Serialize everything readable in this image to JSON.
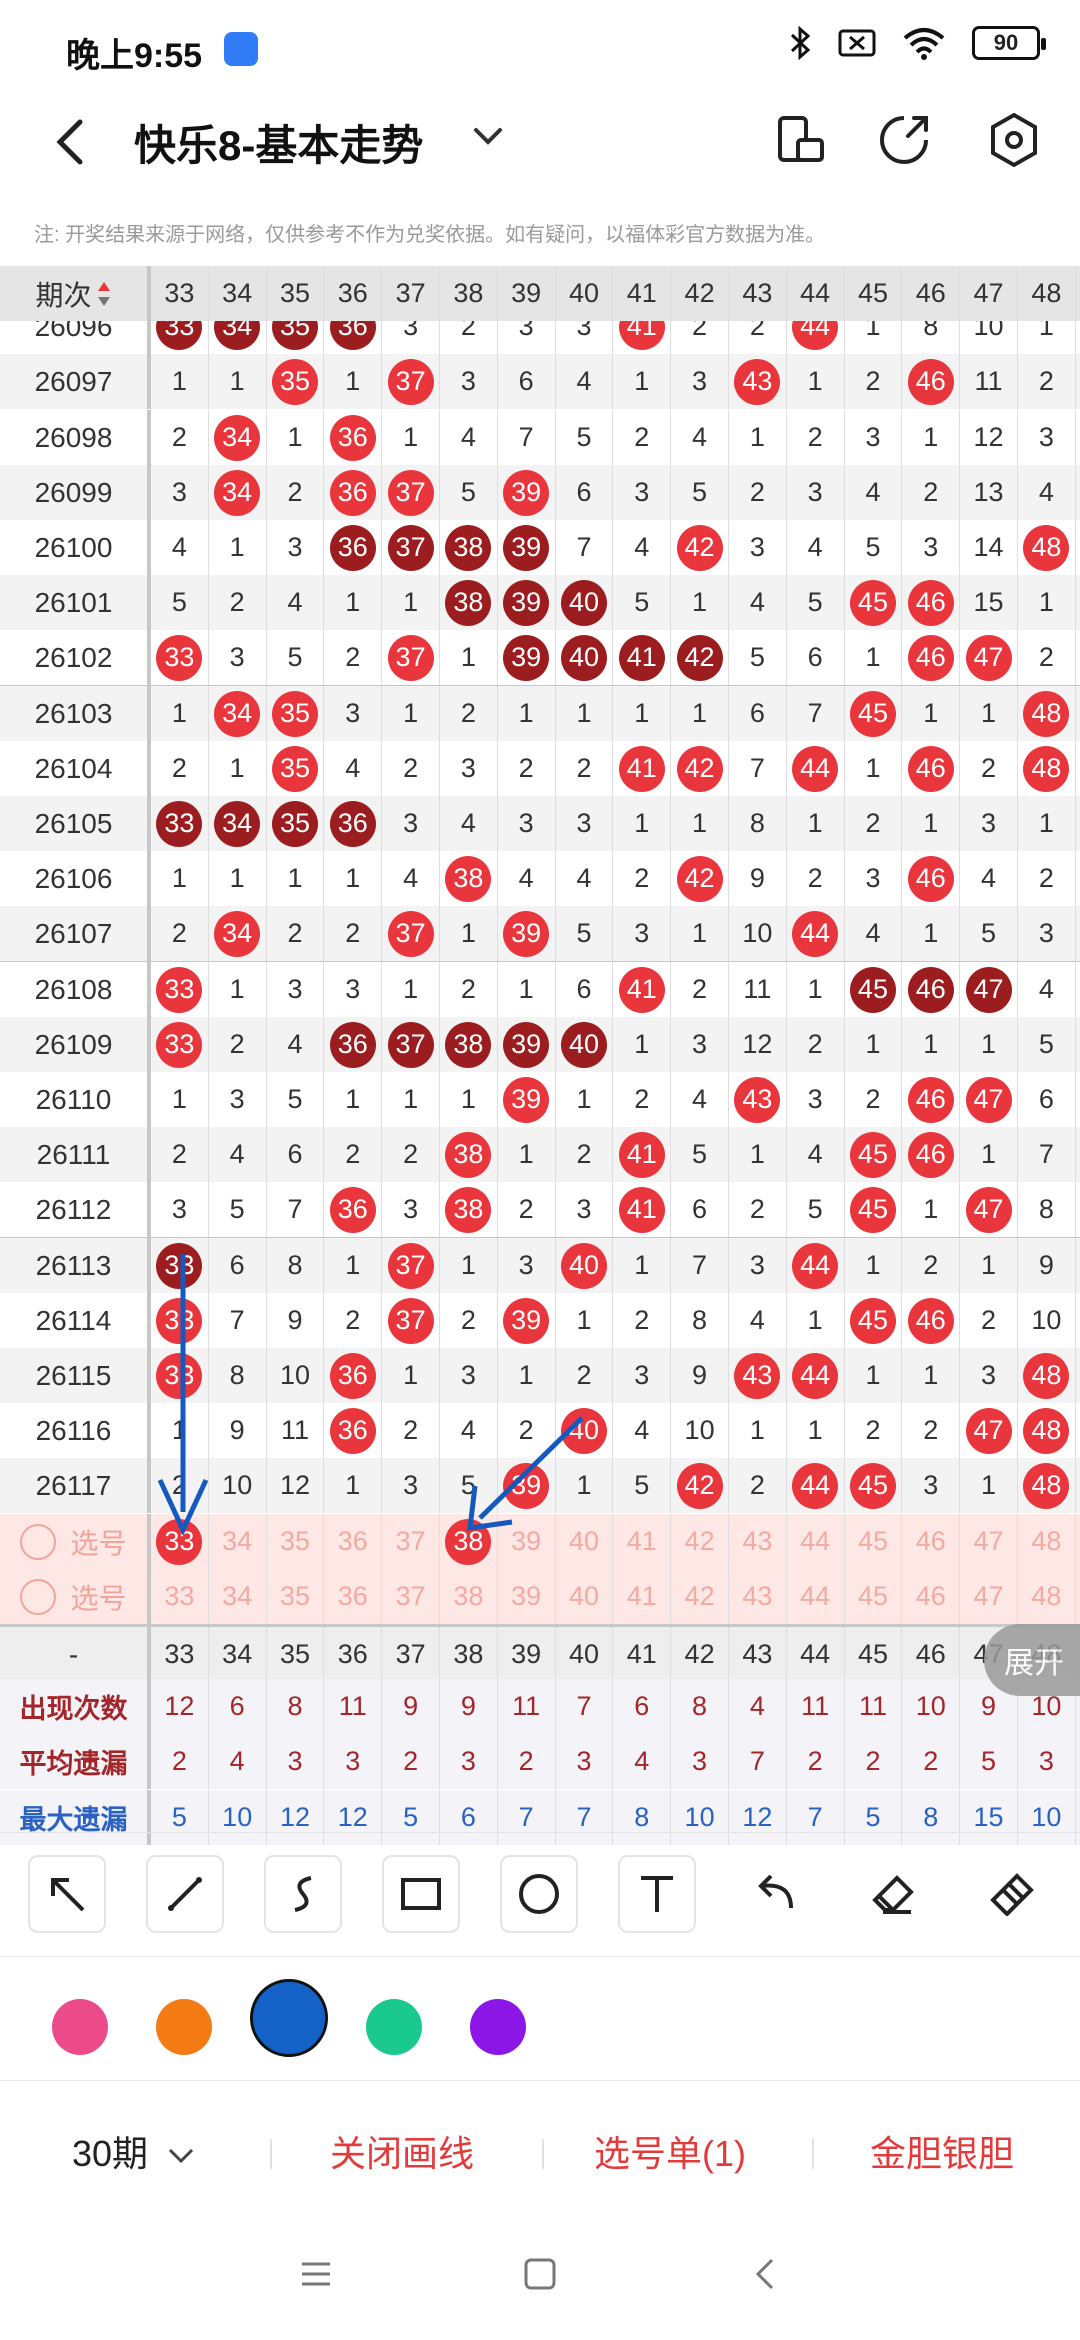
{
  "status": {
    "time": "晚上9:55",
    "battery": "90"
  },
  "header": {
    "title": "快乐8-基本走势"
  },
  "notice": "注: 开奖结果来源于网络，仅供参考不作为兑奖依据。如有疑问，以福体彩官方数据为准。",
  "table": {
    "corner_label": "期次",
    "columns": [
      "33",
      "34",
      "35",
      "36",
      "37",
      "38",
      "39",
      "40",
      "41",
      "42",
      "43",
      "44",
      "45",
      "46",
      "47",
      "48"
    ],
    "partial_row": {
      "period": "26096",
      "cells": [
        "33",
        "34",
        "35",
        "36",
        "3",
        "2",
        "3",
        "3",
        "41",
        "2",
        "2",
        "44",
        "1",
        "8",
        "10",
        "1"
      ]
    },
    "rows": [
      {
        "period": "26097",
        "cells": [
          "1",
          "1",
          "35",
          "1",
          "37",
          "3",
          "6",
          "4",
          "1",
          "3",
          "43",
          "1",
          "2",
          "46",
          "11",
          "2"
        ]
      },
      {
        "period": "26098",
        "cells": [
          "2",
          "34",
          "1",
          "36",
          "1",
          "4",
          "7",
          "5",
          "2",
          "4",
          "1",
          "2",
          "3",
          "1",
          "12",
          "3"
        ]
      },
      {
        "period": "26099",
        "cells": [
          "3",
          "34",
          "2",
          "36",
          "37",
          "5",
          "39",
          "6",
          "3",
          "5",
          "2",
          "3",
          "4",
          "2",
          "13",
          "4"
        ]
      },
      {
        "period": "26100",
        "cells": [
          "4",
          "1",
          "3",
          "36",
          "37",
          "38",
          "39",
          "7",
          "4",
          "42",
          "3",
          "4",
          "5",
          "3",
          "14",
          "48"
        ]
      },
      {
        "period": "26101",
        "cells": [
          "5",
          "2",
          "4",
          "1",
          "1",
          "38",
          "39",
          "40",
          "5",
          "1",
          "4",
          "5",
          "45",
          "46",
          "15",
          "1"
        ]
      },
      {
        "period": "26102",
        "cells": [
          "33",
          "3",
          "5",
          "2",
          "37",
          "1",
          "39",
          "40",
          "41",
          "42",
          "5",
          "6",
          "1",
          "46",
          "47",
          "2"
        ]
      },
      {
        "period": "26103",
        "cells": [
          "1",
          "34",
          "35",
          "3",
          "1",
          "2",
          "1",
          "1",
          "1",
          "1",
          "6",
          "7",
          "45",
          "1",
          "1",
          "48"
        ]
      },
      {
        "period": "26104",
        "cells": [
          "2",
          "1",
          "35",
          "4",
          "2",
          "3",
          "2",
          "2",
          "41",
          "42",
          "7",
          "44",
          "1",
          "46",
          "2",
          "48"
        ]
      },
      {
        "period": "26105",
        "cells": [
          "33",
          "34",
          "35",
          "36",
          "3",
          "4",
          "3",
          "3",
          "1",
          "1",
          "8",
          "1",
          "2",
          "1",
          "3",
          "1"
        ]
      },
      {
        "period": "26106",
        "cells": [
          "1",
          "1",
          "1",
          "1",
          "4",
          "38",
          "4",
          "4",
          "2",
          "42",
          "9",
          "2",
          "3",
          "46",
          "4",
          "2"
        ]
      },
      {
        "period": "26107",
        "cells": [
          "2",
          "34",
          "2",
          "2",
          "37",
          "1",
          "39",
          "5",
          "3",
          "1",
          "10",
          "44",
          "4",
          "1",
          "5",
          "3"
        ]
      },
      {
        "period": "26108",
        "cells": [
          "33",
          "1",
          "3",
          "3",
          "1",
          "2",
          "1",
          "6",
          "41",
          "2",
          "11",
          "1",
          "45",
          "46",
          "47",
          "4"
        ]
      },
      {
        "period": "26109",
        "cells": [
          "33",
          "2",
          "4",
          "36",
          "37",
          "38",
          "39",
          "40",
          "1",
          "3",
          "12",
          "2",
          "1",
          "1",
          "1",
          "5"
        ]
      },
      {
        "period": "26110",
        "cells": [
          "1",
          "3",
          "5",
          "1",
          "1",
          "1",
          "39",
          "1",
          "2",
          "4",
          "43",
          "3",
          "2",
          "46",
          "47",
          "6"
        ]
      },
      {
        "period": "26111",
        "cells": [
          "2",
          "4",
          "6",
          "2",
          "2",
          "38",
          "1",
          "2",
          "41",
          "5",
          "1",
          "4",
          "45",
          "46",
          "1",
          "7"
        ]
      },
      {
        "period": "26112",
        "cells": [
          "3",
          "5",
          "7",
          "36",
          "3",
          "38",
          "2",
          "3",
          "41",
          "6",
          "2",
          "5",
          "45",
          "1",
          "47",
          "8"
        ]
      },
      {
        "period": "26113",
        "cells": [
          "33",
          "6",
          "8",
          "1",
          "37",
          "1",
          "3",
          "40",
          "1",
          "7",
          "3",
          "44",
          "1",
          "2",
          "1",
          "9"
        ]
      },
      {
        "period": "26114",
        "cells": [
          "33",
          "7",
          "9",
          "2",
          "37",
          "2",
          "39",
          "1",
          "2",
          "8",
          "4",
          "1",
          "45",
          "46",
          "2",
          "10"
        ]
      },
      {
        "period": "26115",
        "cells": [
          "33",
          "8",
          "10",
          "36",
          "1",
          "3",
          "1",
          "2",
          "3",
          "9",
          "43",
          "44",
          "1",
          "1",
          "3",
          "48"
        ]
      },
      {
        "period": "26116",
        "cells": [
          "1",
          "9",
          "11",
          "36",
          "2",
          "4",
          "2",
          "40",
          "4",
          "10",
          "1",
          "1",
          "2",
          "2",
          "47",
          "48"
        ]
      },
      {
        "period": "26117",
        "cells": [
          "2",
          "10",
          "12",
          "1",
          "3",
          "5",
          "39",
          "1",
          "5",
          "42",
          "2",
          "44",
          "45",
          "3",
          "1",
          "48"
        ]
      }
    ],
    "pick_rows": [
      {
        "label": "选号",
        "cells": [
          "33",
          "34",
          "35",
          "36",
          "37",
          "38",
          "39",
          "40",
          "41",
          "42",
          "43",
          "44",
          "45",
          "46",
          "47",
          "48"
        ],
        "selected": [
          "33",
          "38"
        ]
      },
      {
        "label": "选号",
        "cells": [
          "33",
          "34",
          "35",
          "36",
          "37",
          "38",
          "39",
          "40",
          "41",
          "42",
          "43",
          "44",
          "45",
          "46",
          "47",
          "48"
        ],
        "selected": []
      }
    ],
    "stats_header": {
      "label": "-",
      "cells": [
        "33",
        "34",
        "35",
        "36",
        "37",
        "38",
        "39",
        "40",
        "41",
        "42",
        "43",
        "44",
        "45",
        "46",
        "47",
        "48"
      ]
    },
    "stats": [
      {
        "label": "出现次数",
        "color": "#a3262a",
        "cells": [
          "12",
          "6",
          "8",
          "11",
          "9",
          "9",
          "11",
          "7",
          "6",
          "8",
          "4",
          "11",
          "11",
          "10",
          "9",
          "10"
        ]
      },
      {
        "label": "平均遗漏",
        "color": "#a3262a",
        "cells": [
          "2",
          "4",
          "3",
          "3",
          "2",
          "3",
          "2",
          "3",
          "4",
          "3",
          "7",
          "2",
          "2",
          "2",
          "5",
          "3"
        ]
      },
      {
        "label": "最大遗漏",
        "color": "#2a62c4",
        "cells": [
          "5",
          "10",
          "12",
          "12",
          "5",
          "6",
          "7",
          "7",
          "8",
          "10",
          "12",
          "7",
          "5",
          "8",
          "15",
          "10"
        ]
      }
    ]
  },
  "expand_label": "展开",
  "tools": [
    "arrow-tool",
    "line-tool",
    "curve-tool",
    "rect-tool",
    "circle-tool",
    "text-tool",
    "undo-tool",
    "eraser-tool",
    "clear-tool"
  ],
  "colors": [
    "#ec4b8a",
    "#f47a14",
    "#1462c8",
    "#19c98e",
    "#8b16e6"
  ],
  "bottom": {
    "period_select": "30期",
    "close_lines": "关闭画线",
    "pick_list": "选号单(1)",
    "gold_silver": "金胆银胆"
  }
}
